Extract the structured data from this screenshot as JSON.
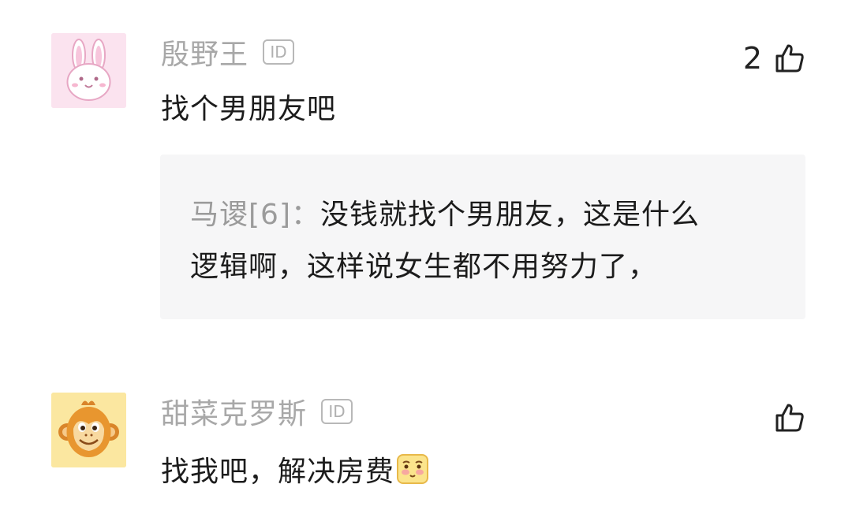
{
  "comments": [
    {
      "username": "殷野王",
      "id_badge": "ID",
      "likes": "2",
      "content": "找个男朋友吧",
      "avatar_icon": "pink-rabbit-avatar-icon",
      "reply": {
        "author": "马谡[6]：",
        "line1": "没钱就找个男朋友，这是什么",
        "line2": "逻辑啊，这样说女生都不用努力了，"
      }
    },
    {
      "username": "甜菜克罗斯",
      "id_badge": "ID",
      "likes": "",
      "content": "找我吧，解决房费",
      "avatar_icon": "monkey-avatar-icon",
      "emoji": "blushing-face-emoji"
    }
  ],
  "colors": {
    "username": "#a8a8a8",
    "text": "#1c1c1c",
    "reply_bg": "#f6f6f7",
    "reply_author": "#9b9b9b"
  }
}
